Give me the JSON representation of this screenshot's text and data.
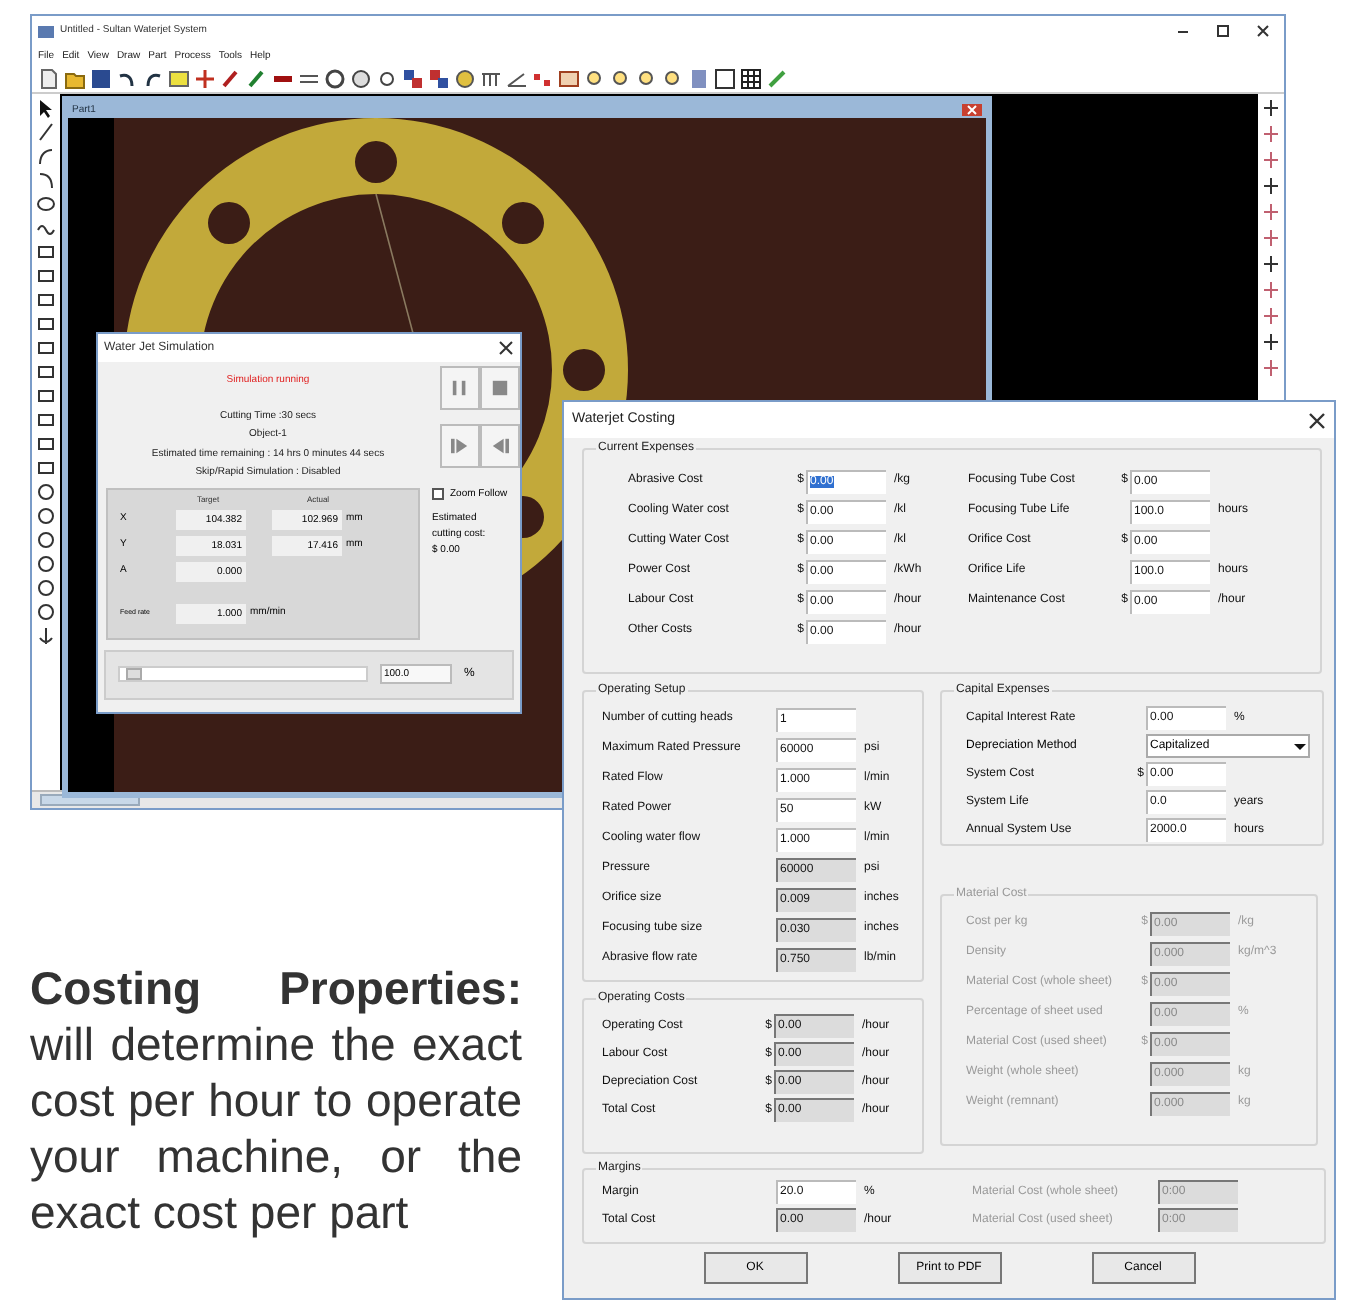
{
  "main_window": {
    "title": "Untitled - Sultan Waterjet System",
    "menu": [
      "File",
      "Edit",
      "View",
      "Draw",
      "Part",
      "Process",
      "Tools",
      "Help"
    ],
    "canvas_window": {
      "title": "Part1"
    }
  },
  "simulation_dialog": {
    "title": "Water Jet Simulation",
    "status": "Simulation running",
    "info": [
      "Cutting Time :30 secs",
      "Object-1",
      "Estimated time remaining : 14 hrs 0 minutes 44 secs",
      "Skip/Rapid Simulation : Disabled"
    ],
    "columns": [
      "Target",
      "Actual"
    ],
    "coordinates": [
      {
        "axis": "X",
        "target": "104.382",
        "actual": "102.969",
        "unit": "mm"
      },
      {
        "axis": "Y",
        "target": "18.031",
        "actual": "17.416",
        "unit": "mm"
      },
      {
        "axis": "A",
        "target": "0.000"
      }
    ],
    "feed_rate": {
      "label": "Feed rate",
      "value": "1.000",
      "unit": "mm/min"
    },
    "zoom_follow": {
      "label": "Zoom Follow",
      "checked": false
    },
    "estimated_cost": [
      "Estimated",
      "cutting cost:",
      "$ 0.00"
    ],
    "slider": {
      "level": 0.03
    },
    "speed": {
      "value": "100.0",
      "unit": "%"
    }
  },
  "costing_dialog": {
    "title": "Waterjet Costing",
    "current_expenses": {
      "title": "Current Expenses",
      "left": [
        {
          "label": "Abrasive Cost",
          "prefix": "$",
          "value": "0.00",
          "unit": "/kg",
          "text_selected": true
        },
        {
          "label": "Cooling Water cost",
          "prefix": "$",
          "value": "0.00",
          "unit": "/kl",
          "text_selected": false
        },
        {
          "label": "Cutting Water Cost",
          "prefix": "$",
          "value": "0.00",
          "unit": "/kl",
          "text_selected": false
        },
        {
          "label": "Power Cost",
          "prefix": "$",
          "value": "0.00",
          "unit": "/kWh",
          "text_selected": false
        },
        {
          "label": "Labour Cost",
          "prefix": "$",
          "value": "0.00",
          "unit": "/hour",
          "text_selected": false
        },
        {
          "label": "Other Costs",
          "prefix": "$",
          "value": "0.00",
          "unit": "/hour",
          "text_selected": false
        }
      ],
      "right": [
        {
          "label": "Focusing Tube Cost",
          "prefix": "$",
          "value": "0.00",
          "text_selected": false
        },
        {
          "label": "Focusing Tube Life",
          "value": "100.0",
          "unit": "hours",
          "text_selected": false
        },
        {
          "label": "Orifice Cost",
          "prefix": "$",
          "value": "0.00",
          "text_selected": false
        },
        {
          "label": "Orifice Life",
          "value": "100.0",
          "unit": "hours",
          "text_selected": false
        },
        {
          "label": "Maintenance Cost",
          "prefix": "$",
          "value": "0.00",
          "unit": "/hour",
          "text_selected": false
        }
      ]
    },
    "operating_setup": {
      "title": "Operating Setup",
      "fields": [
        {
          "label": "Number of cutting heads",
          "value": "1",
          "readonly": false
        },
        {
          "label": "Maximum Rated Pressure",
          "value": "60000",
          "unit": "psi",
          "readonly": false
        },
        {
          "label": "Rated Flow",
          "value": "1.000",
          "unit": "l/min",
          "readonly": false
        },
        {
          "label": "Rated Power",
          "value": "50",
          "unit": "kW",
          "readonly": false
        },
        {
          "label": "Cooling water flow",
          "value": "1.000",
          "unit": "l/min",
          "readonly": false
        },
        {
          "label": "Pressure",
          "value": "60000",
          "unit": "psi",
          "readonly": true
        },
        {
          "label": "Orifice size",
          "value": "0.009",
          "unit": "inches",
          "readonly": true
        },
        {
          "label": "Focusing tube size",
          "value": "0.030",
          "unit": "inches",
          "readonly": true
        },
        {
          "label": "Abrasive flow rate",
          "value": "0.750",
          "unit": "lb/min",
          "readonly": true
        }
      ]
    },
    "capital_expenses": {
      "title": "Capital Expenses",
      "fields": [
        {
          "kind": "field",
          "label": "Capital Interest Rate",
          "value": "0.00",
          "unit": "%"
        },
        {
          "kind": "dropdown",
          "label": "Depreciation Method",
          "value": "Capitalized"
        },
        {
          "kind": "field",
          "label": "System Cost",
          "prefix": "$",
          "value": "0.00"
        },
        {
          "kind": "field",
          "label": "System Life",
          "value": "0.0",
          "unit": "years"
        },
        {
          "kind": "field",
          "label": "Annual System Use",
          "value": "2000.0",
          "unit": "hours"
        }
      ]
    },
    "material_cost": {
      "title": "Material Cost",
      "disabled": true,
      "fields": [
        {
          "label": "Cost per kg",
          "prefix": "$",
          "value": "0.00",
          "unit": "/kg"
        },
        {
          "label": "Density",
          "value": "0.000",
          "unit": "kg/m^3"
        },
        {
          "label": "Material Cost (whole sheet)",
          "prefix": "$",
          "value": "0.00"
        },
        {
          "label": "Percentage of sheet used",
          "value": "0.00",
          "unit": "%"
        },
        {
          "label": "Material Cost (used sheet)",
          "prefix": "$",
          "value": "0.00"
        },
        {
          "label": "Weight (whole sheet)",
          "value": "0.000",
          "unit": "kg"
        },
        {
          "label": "Weight (remnant)",
          "value": "0.000",
          "unit": "kg"
        }
      ]
    },
    "operating_costs": {
      "title": "Operating Costs",
      "fields": [
        {
          "label": "Operating Cost",
          "prefix": "$",
          "value": "0.00",
          "unit": "/hour"
        },
        {
          "label": "Labour Cost",
          "prefix": "$",
          "value": "0.00",
          "unit": "/hour"
        },
        {
          "label": "Depreciation Cost",
          "prefix": "$",
          "value": "0.00",
          "unit": "/hour"
        },
        {
          "label": "Total Cost",
          "prefix": "$",
          "value": "0.00",
          "unit": "/hour"
        }
      ]
    },
    "margins": {
      "title": "Margins",
      "left": [
        {
          "label": "Margin",
          "value": "20.0",
          "unit": "%",
          "readonly": false
        },
        {
          "label": "Total Cost",
          "value": "0.00",
          "unit": "/hour",
          "readonly": true
        }
      ],
      "right": [
        {
          "label": "Material Cost (whole sheet)",
          "value": "0:00"
        },
        {
          "label": "Material Cost (used sheet)",
          "value": "0:00"
        }
      ]
    },
    "buttons": [
      "OK",
      "Print to PDF",
      "Cancel"
    ]
  },
  "description": "**Costing Properties:** will determine the exact cost per hour to operate your machine, or the exact cost per part"
}
